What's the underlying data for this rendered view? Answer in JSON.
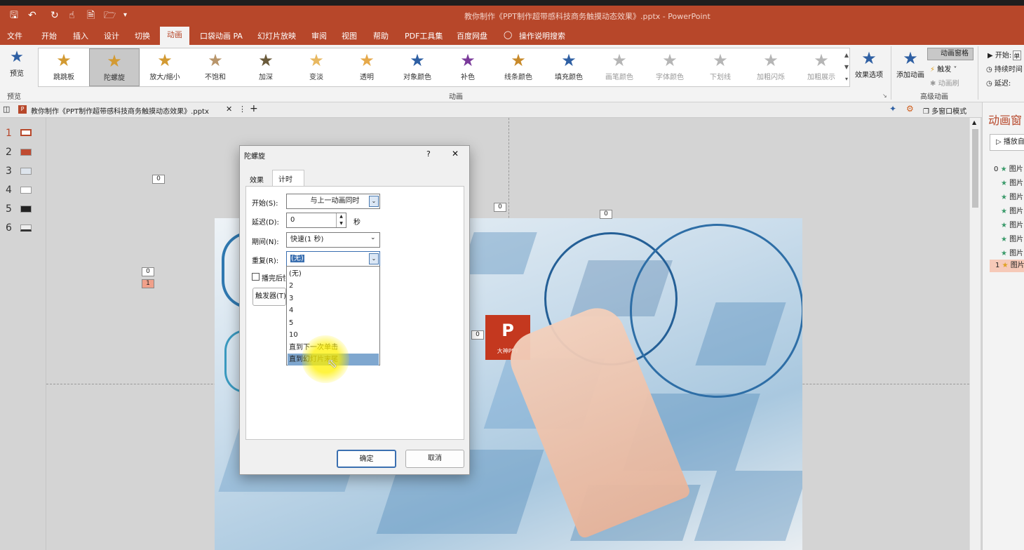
{
  "window": {
    "title": "教你制作《PPT制作超带感科技商务触摸动态效果》.pptx - PowerPoint"
  },
  "quick_access": [
    "save-icon",
    "undo-icon",
    "redo-icon",
    "touch-icon",
    "new-icon",
    "open-icon",
    "customize-icon"
  ],
  "menu": {
    "tabs": [
      "文件",
      "开始",
      "插入",
      "设计",
      "切换",
      "动画",
      "口袋动画 PA",
      "幻灯片放映",
      "审阅",
      "视图",
      "帮助",
      "PDF工具集",
      "百度网盘",
      "操作说明搜索"
    ],
    "active": "动画"
  },
  "ribbon": {
    "preview": "预览",
    "preview_group": "预览",
    "effects": [
      "跳跳板",
      "陀螺旋",
      "放大/缩小",
      "不饱和",
      "加深",
      "变淡",
      "透明",
      "对象颜色",
      "补色",
      "线条颜色",
      "填充颜色",
      "画笔颜色",
      "字体颜色",
      "下划线",
      "加粗闪烁",
      "加粗展示"
    ],
    "selected_effect": "陀螺旋",
    "effect_options": "效果选项",
    "animation_group": "动画",
    "add_animation": "添加动画",
    "animation_pane": "动画窗格",
    "trigger": "触发",
    "animation_painter": "动画刷",
    "advanced_group": "高级动画",
    "start_label": "开始:",
    "start_value": "单",
    "duration_label": "持续时间",
    "delay_label": "延迟:"
  },
  "file_tab": {
    "name": "教你制作《PPT制作超带感科技商务触摸动态效果》.pptx",
    "add": "+",
    "multi_window": "多窗口模式"
  },
  "slides": {
    "numbers": [
      "1",
      "2",
      "3",
      "4",
      "5",
      "6"
    ]
  },
  "slide": {
    "tags": [
      "0",
      "0",
      "1",
      "0",
      "0",
      "0"
    ],
    "logo_text": "P",
    "logo_sub": "大神PPT"
  },
  "anim_pane": {
    "title": "动画窗",
    "play": "播放自",
    "items": [
      "0",
      "",
      "",
      "",
      "",
      "",
      "",
      "1"
    ],
    "item_text": "图片"
  },
  "dialog": {
    "title": "陀螺旋",
    "help": "?",
    "close": "✕",
    "tabs": [
      "效果",
      "计时"
    ],
    "active_tab": "计时",
    "start_label": "开始(S):",
    "start_value": "与上一动画同时",
    "delay_label": "延迟(D):",
    "delay_value": "0",
    "delay_unit": "秒",
    "period_label": "期间(N):",
    "period_value": "快速(1 秒)",
    "repeat_label": "重复(R):",
    "repeat_value": "(无)",
    "rewind_label": "播完后快退",
    "trigger_label": "触发器(T)",
    "repeat_options": [
      "(无)",
      "2",
      "3",
      "4",
      "5",
      "10",
      "直到下一次单击",
      "直到幻灯片末尾"
    ],
    "highlighted_option": "直到幻灯片末尾",
    "ok": "确定",
    "cancel": "取消"
  }
}
